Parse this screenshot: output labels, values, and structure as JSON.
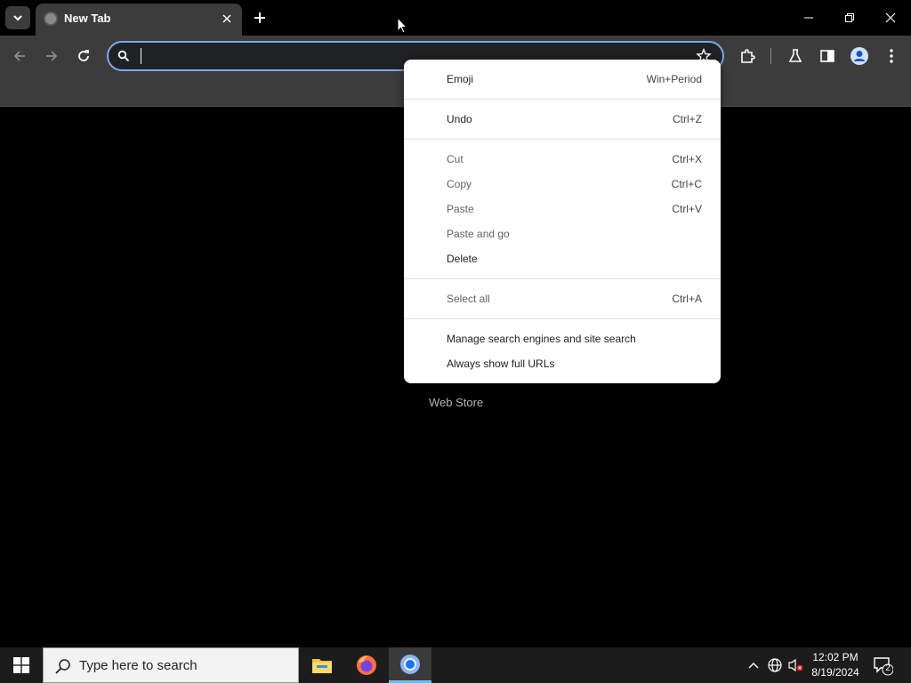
{
  "browser": {
    "tab": {
      "title": "New Tab"
    },
    "omnibox": {
      "value": "",
      "placeholder": ""
    }
  },
  "content": {
    "web_store_label": "Web Store"
  },
  "context_menu": {
    "items": [
      {
        "label": "Emoji",
        "shortcut": "Win+Period"
      },
      {
        "label": "Undo",
        "shortcut": "Ctrl+Z"
      },
      {
        "label": "Cut",
        "shortcut": "Ctrl+X"
      },
      {
        "label": "Copy",
        "shortcut": "Ctrl+C"
      },
      {
        "label": "Paste",
        "shortcut": "Ctrl+V"
      },
      {
        "label": "Paste and go",
        "shortcut": ""
      },
      {
        "label": "Delete",
        "shortcut": ""
      },
      {
        "label": "Select all",
        "shortcut": "Ctrl+A"
      },
      {
        "label": "Manage search engines and site search",
        "shortcut": ""
      },
      {
        "label": "Always show full URLs",
        "shortcut": ""
      }
    ]
  },
  "taskbar": {
    "search_placeholder": "Type here to search",
    "time": "12:02 PM",
    "date": "8/19/2024",
    "notification_count": "2"
  },
  "colors": {
    "omnibox_focus": "#7ca7f0",
    "toolbar": "#3c3c3c",
    "active_task_indicator": "#76b9ed"
  }
}
